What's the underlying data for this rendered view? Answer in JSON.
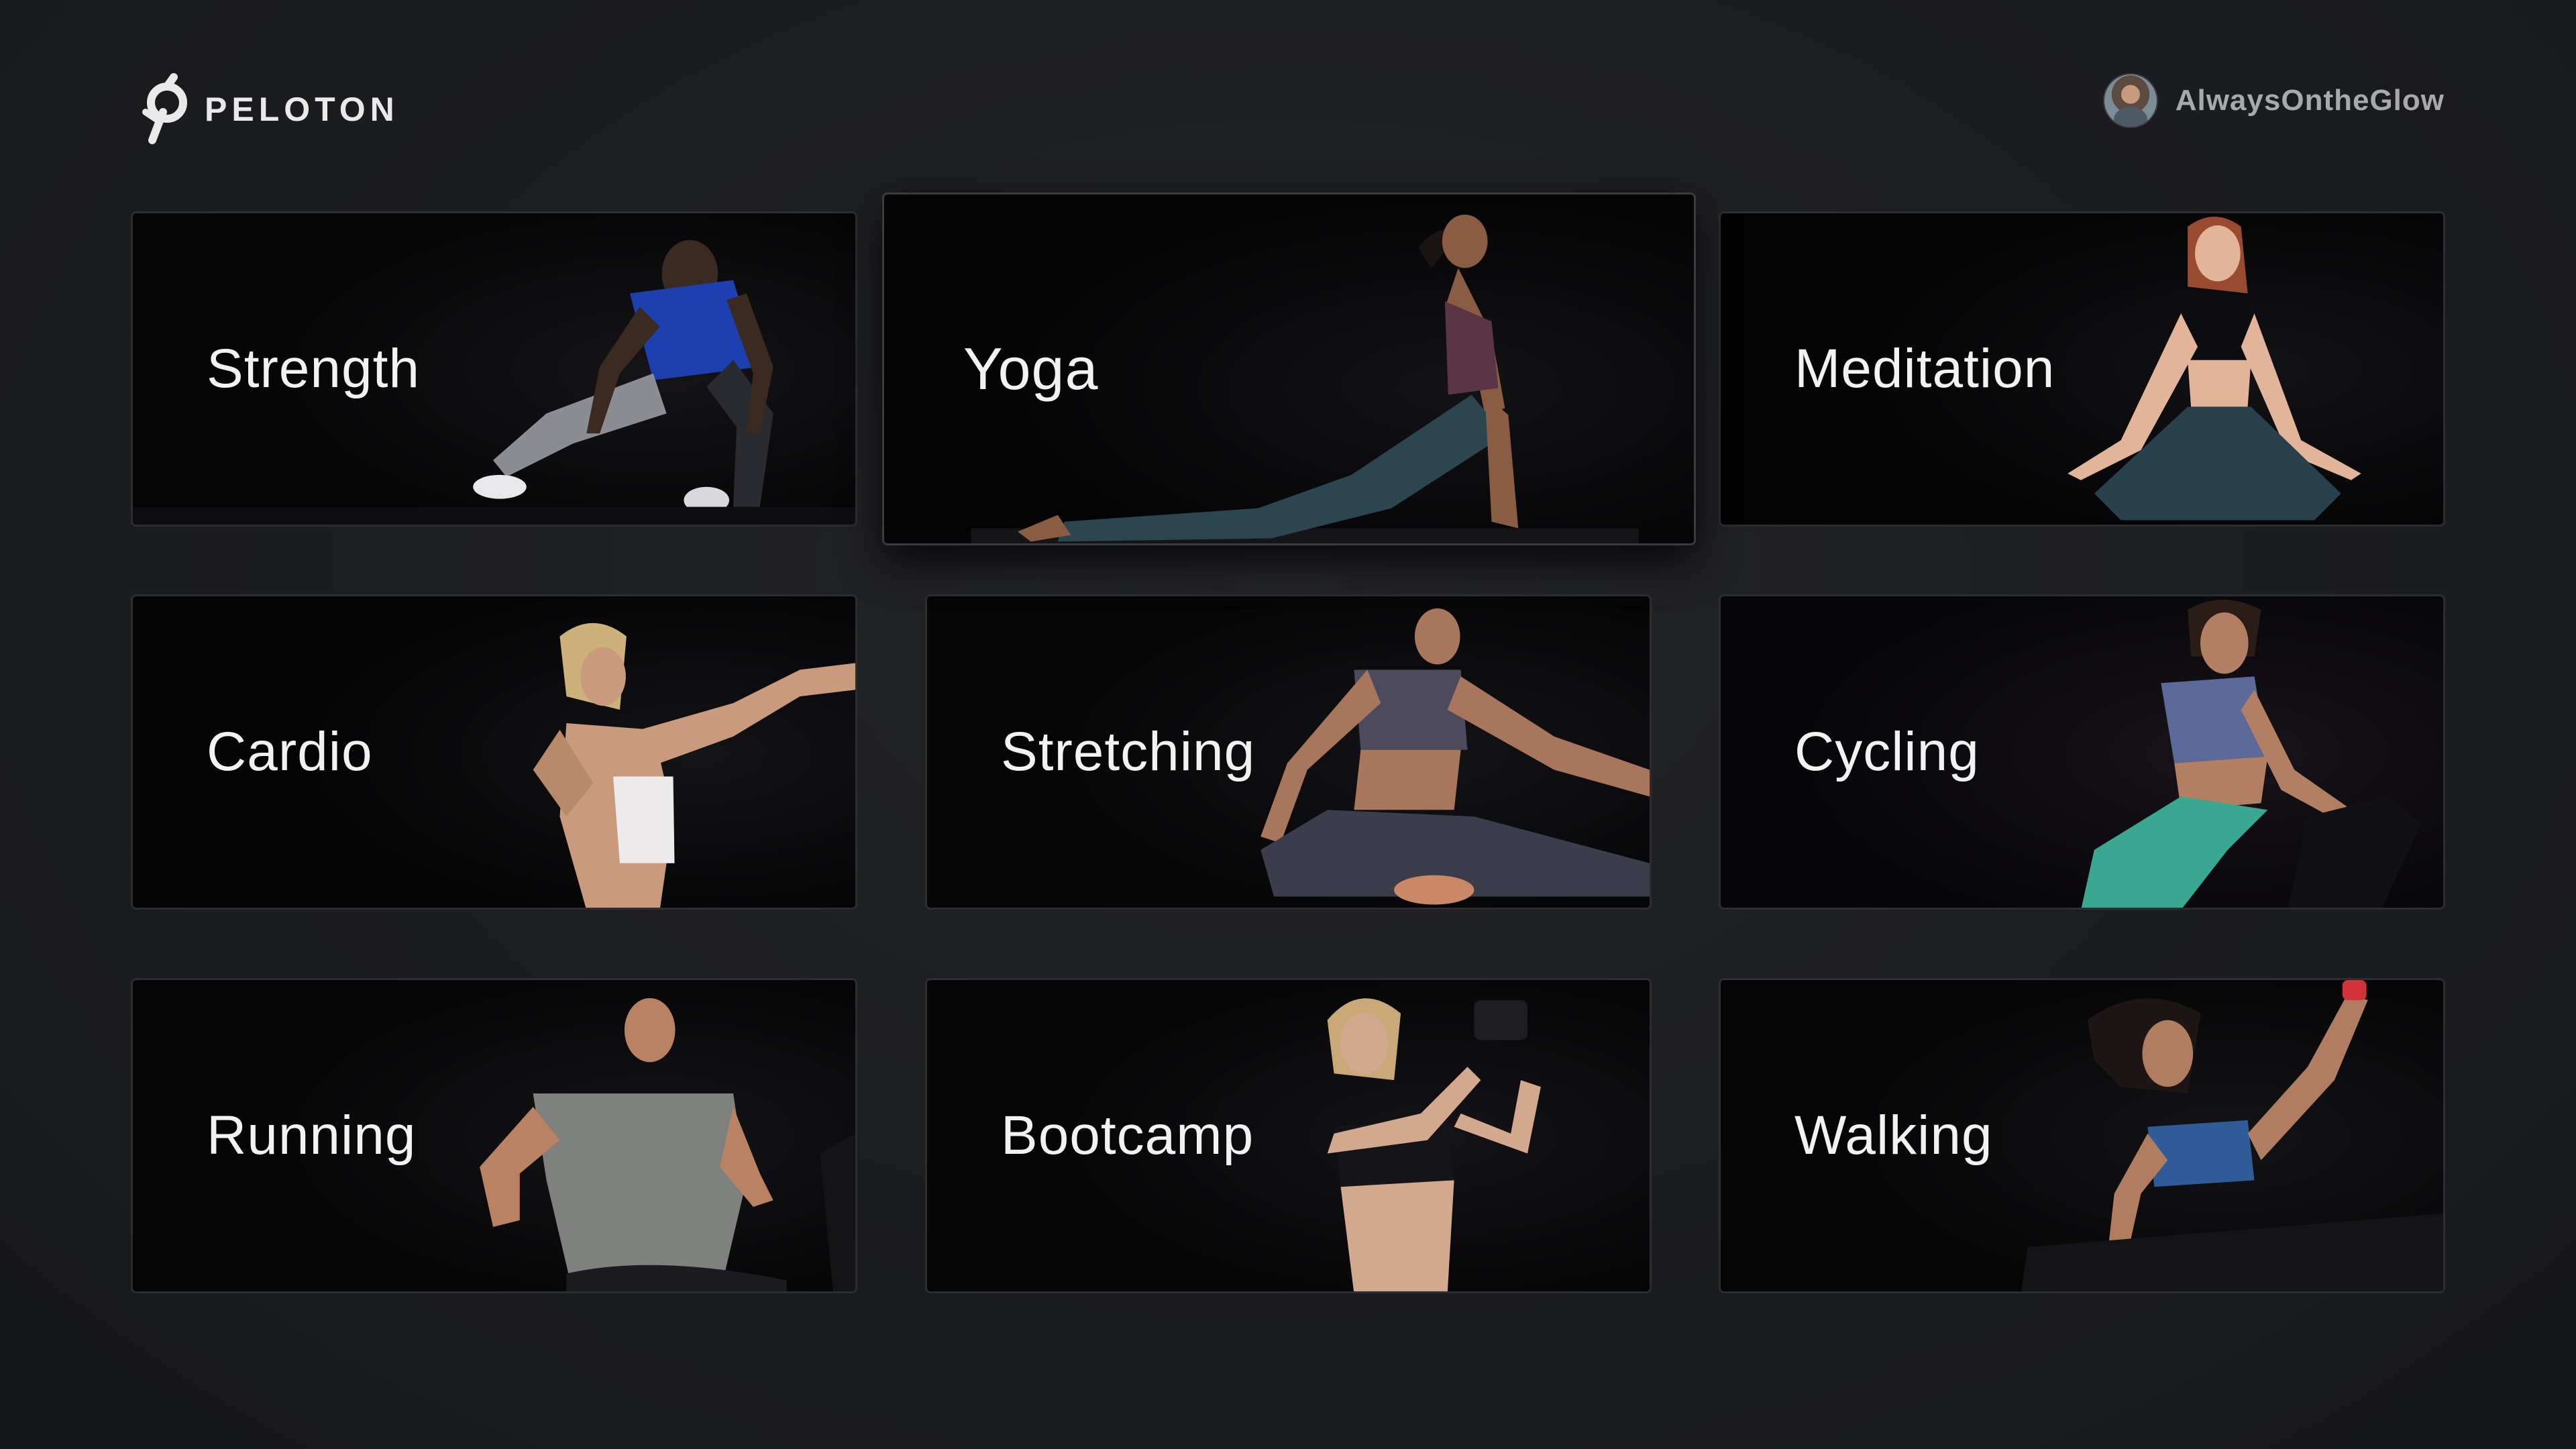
{
  "brand": {
    "logo_text": "PELOTON",
    "logo_icon": "peloton-p-logo-icon"
  },
  "user": {
    "username": "AlwaysOntheGlow",
    "avatar_icon": "user-avatar"
  },
  "categories": [
    {
      "label": "Strength"
    },
    {
      "label": "Yoga"
    },
    {
      "label": "Meditation"
    },
    {
      "label": "Cardio"
    },
    {
      "label": "Stretching"
    },
    {
      "label": "Cycling"
    },
    {
      "label": "Running"
    },
    {
      "label": "Bootcamp"
    },
    {
      "label": "Walking"
    }
  ],
  "focused_category": "Yoga",
  "colors": {
    "background": "#1c1d20",
    "tile_background": "#050506",
    "tile_border": "#2c2d31",
    "label_text": "#f2f2f3",
    "username_text": "#a8a9ad"
  }
}
